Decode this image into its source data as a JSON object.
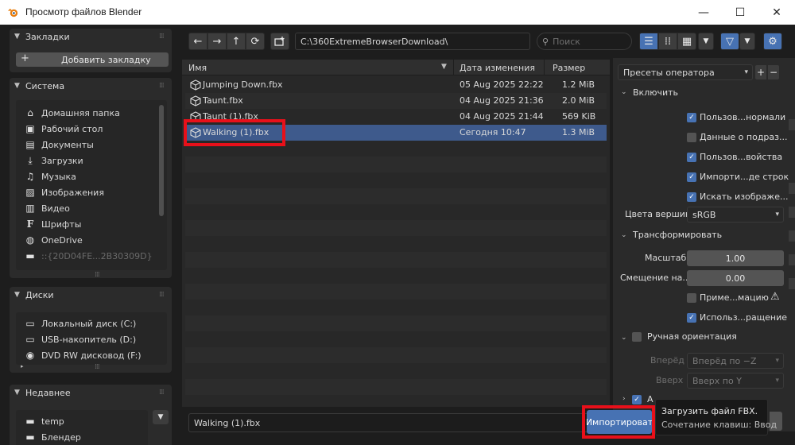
{
  "window": {
    "title": "Просмотр файлов Blender",
    "minimize": "—",
    "maximize": "☐",
    "close": "✕"
  },
  "sidebar": {
    "bookmarks": {
      "title": "Закладки",
      "add_button": "Добавить закладку"
    },
    "system": {
      "title": "Система",
      "items": [
        {
          "label": "Домашняя папка",
          "icon": "home-icon"
        },
        {
          "label": "Рабочий стол",
          "icon": "desktop-icon"
        },
        {
          "label": "Документы",
          "icon": "documents-icon"
        },
        {
          "label": "Загрузки",
          "icon": "download-icon"
        },
        {
          "label": "Музыка",
          "icon": "music-icon"
        },
        {
          "label": "Изображения",
          "icon": "image-icon"
        },
        {
          "label": "Видео",
          "icon": "video-icon"
        },
        {
          "label": "Шрифты",
          "icon": "font-icon"
        },
        {
          "label": "OneDrive",
          "icon": "globe-icon"
        },
        {
          "label": "::{20D04FE...2B30309D}",
          "icon": "folder-icon"
        }
      ]
    },
    "drives": {
      "title": "Диски",
      "items": [
        {
          "label": "Локальный диск (C:)",
          "icon": "disk-icon"
        },
        {
          "label": "USB-накопитель (D:)",
          "icon": "usb-icon"
        },
        {
          "label": "DVD RW дисковод (F:)",
          "icon": "dvd-icon"
        }
      ]
    },
    "recent": {
      "title": "Недавнее",
      "items": [
        {
          "label": "temp",
          "icon": "folder-icon"
        },
        {
          "label": "Блендер",
          "icon": "folder-icon"
        }
      ]
    }
  },
  "toolbar": {
    "path": "C:\\360ExtremeBrowserDownload\\",
    "search_placeholder": "Поиск"
  },
  "filelist": {
    "columns": {
      "name": "Имя",
      "date": "Дата изменения",
      "size": "Размер"
    },
    "rows": [
      {
        "name": "Jumping Down.fbx",
        "date": "05 Aug 2025 22:22",
        "size": "1.2 MiB",
        "selected": false
      },
      {
        "name": "Taunt.fbx",
        "date": "04 Aug 2025 21:36",
        "size": "2.0 MiB",
        "selected": false
      },
      {
        "name": "Taunt (1).fbx",
        "date": "04 Aug 2025 21:44",
        "size": "569 KiB",
        "selected": false
      },
      {
        "name": "Walking (1).fbx",
        "date": "Сегодня 10:47",
        "size": "1.3 MiB",
        "selected": true
      }
    ]
  },
  "footer": {
    "filename": "Walking (1).fbx",
    "import_button": "Импортироват",
    "tooltip_line1": "Загрузить файл FBX.",
    "tooltip_line2": "Сочетание клавиш: Ввод"
  },
  "options": {
    "presets": "Пресеты оператора",
    "include": {
      "title": "Включить",
      "checks": [
        {
          "label": "Пользов...нормали",
          "checked": true
        },
        {
          "label": "Данные о подраз...",
          "checked": false
        },
        {
          "label": "Пользов...войства",
          "checked": true
        },
        {
          "label": "Импорти...де строк",
          "checked": true
        },
        {
          "label": "Искать изображе...",
          "checked": true
        }
      ],
      "vertex_colors_label": "Цвета вершин",
      "vertex_colors_value": "sRGB"
    },
    "transform": {
      "title": "Трансформировать",
      "scale_label": "Масштаб",
      "scale_value": "1.00",
      "offset_label": "Смещение на...",
      "offset_value": "0.00",
      "apply_label": "Приме...мацию",
      "apply_checked": false,
      "use_label": "Использ...ращение",
      "use_checked": true
    },
    "orientation": {
      "title": "Ручная ориентация",
      "forward_label": "Вперёд",
      "forward_value": "Вперёд по −Z",
      "up_label": "Вверх",
      "up_value": "Вверх по Y"
    },
    "partial_section": "А"
  },
  "colors": {
    "accent": "#4772b3",
    "selection": "#3e5a8c",
    "highlight_box": "#e8101a"
  }
}
